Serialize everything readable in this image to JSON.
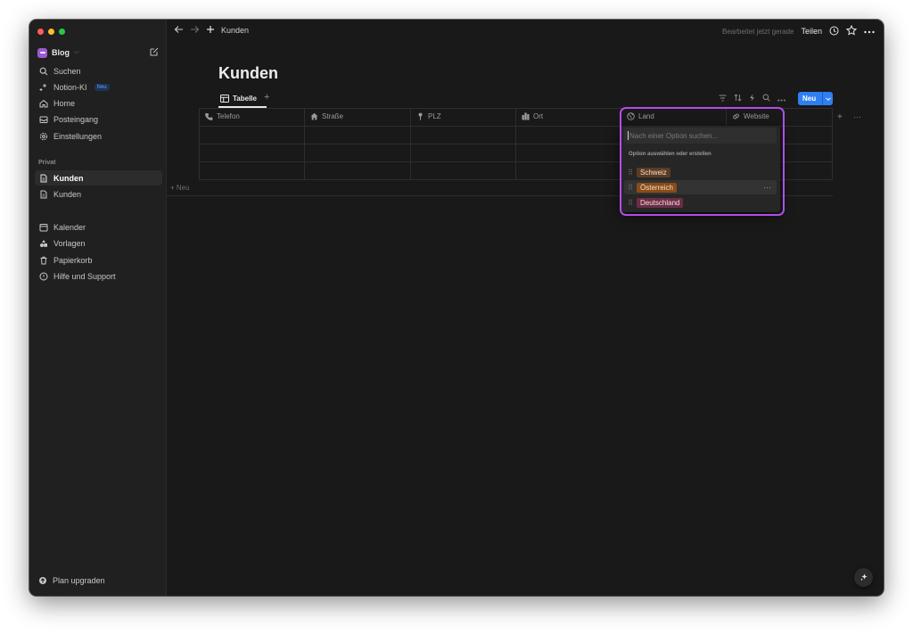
{
  "workspace": {
    "name": "Blog"
  },
  "sidebar": {
    "items": [
      {
        "label": "Suchen",
        "icon": "search-icon"
      },
      {
        "label": "Notion-KI",
        "icon": "sparkle-icon",
        "badge": "Neu"
      },
      {
        "label": "Home",
        "icon": "home-icon"
      },
      {
        "label": "Posteingang",
        "icon": "inbox-icon"
      },
      {
        "label": "Einstellungen",
        "icon": "gear-icon"
      }
    ],
    "section_label": "Privat",
    "pages": [
      {
        "label": "Kunden",
        "icon": "page-icon",
        "active": true
      },
      {
        "label": "Kunden",
        "icon": "page-icon",
        "active": false
      }
    ],
    "tools": [
      {
        "label": "Kalender",
        "icon": "calendar-icon"
      },
      {
        "label": "Vorlagen",
        "icon": "templates-icon"
      },
      {
        "label": "Papierkorb",
        "icon": "trash-icon"
      },
      {
        "label": "Hilfe und Support",
        "icon": "help-icon"
      }
    ],
    "plan_label": "Plan upgraden"
  },
  "topbar": {
    "breadcrumb": "Kunden",
    "status": "Bearbeitet jetzt gerade",
    "share": "Teilen"
  },
  "page": {
    "title": "Kunden"
  },
  "view": {
    "tab_label": "Tabelle",
    "new_button": "Neu"
  },
  "table": {
    "columns": [
      {
        "label": "Telefon",
        "icon": "phone-icon"
      },
      {
        "label": "Straße",
        "icon": "house-icon"
      },
      {
        "label": "PLZ",
        "icon": "pin-icon"
      },
      {
        "label": "Ort",
        "icon": "city-icon"
      },
      {
        "label": "Land",
        "icon": "globe-icon"
      },
      {
        "label": "Website",
        "icon": "link-icon"
      }
    ],
    "add_row_label": "+ Neu"
  },
  "dropdown": {
    "search_placeholder": "Nach einer Option suchen...",
    "section_label": "Option auswählen oder erstellen",
    "options": [
      {
        "label": "Schweiz",
        "color": "#5c3b23"
      },
      {
        "label": "Österreich",
        "color": "#8a4b17"
      },
      {
        "label": "Deutschland",
        "color": "#6b2d4a"
      }
    ],
    "highlight_color": "#b14ee6"
  },
  "colors": {
    "accent": "#2f7ff2",
    "background": "#191919",
    "sidebar": "#202020"
  }
}
